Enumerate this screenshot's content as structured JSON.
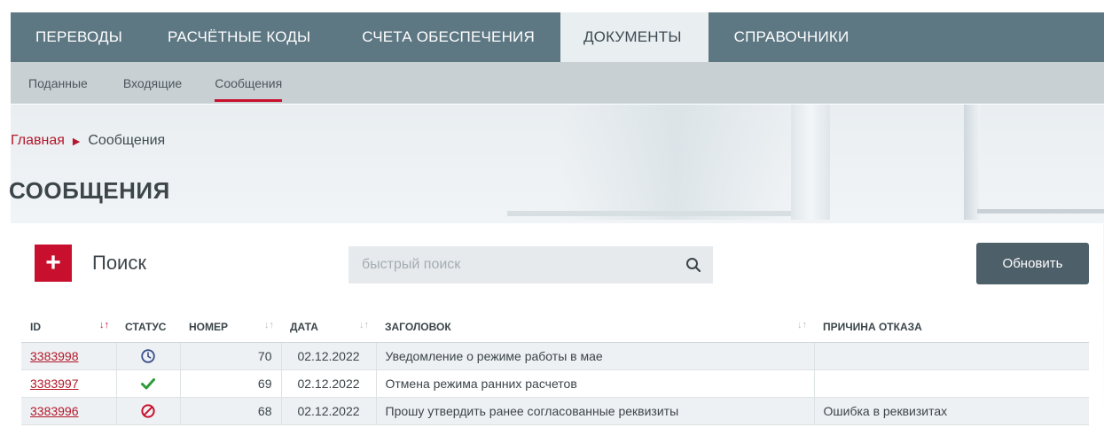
{
  "topnav": {
    "items": [
      {
        "label": "ПЕРЕВОДЫ",
        "active": false
      },
      {
        "label": "РАСЧЁТНЫЕ КОДЫ",
        "active": false
      },
      {
        "label": "СЧЕТА ОБЕСПЕЧЕНИЯ",
        "active": false
      },
      {
        "label": "ДОКУМЕНТЫ",
        "active": true
      },
      {
        "label": "СПРАВОЧНИКИ",
        "active": false
      }
    ]
  },
  "subnav": {
    "items": [
      {
        "label": "Поданные",
        "active": false
      },
      {
        "label": "Входящие",
        "active": false
      },
      {
        "label": "Сообщения",
        "active": true
      }
    ]
  },
  "breadcrumb": {
    "home": "Главная",
    "current": "Сообщения"
  },
  "page_title": "СООБЩЕНИЯ",
  "toolbar": {
    "add_icon": "plus-icon",
    "search_label": "Поиск",
    "quick_search_placeholder": "быстрый поиск",
    "quick_search_value": "",
    "search_icon": "magnifier-icon",
    "refresh_label": "Обновить"
  },
  "table": {
    "columns": [
      {
        "key": "id",
        "label": "ID",
        "sort": "active-desc"
      },
      {
        "key": "status",
        "label": "СТАТУС",
        "sort": "none"
      },
      {
        "key": "number",
        "label": "НОМЕР",
        "sort": "sortable"
      },
      {
        "key": "date",
        "label": "ДАТА",
        "sort": "sortable"
      },
      {
        "key": "title",
        "label": "ЗАГОЛОВОК",
        "sort": "sortable"
      },
      {
        "key": "reason",
        "label": "ПРИЧИНА ОТКАЗА",
        "sort": "none"
      }
    ],
    "rows": [
      {
        "id": "3383998",
        "status": "clock-icon",
        "number": "70",
        "date": "02.12.2022",
        "title": "Уведомление о режиме работы в мае",
        "reason": ""
      },
      {
        "id": "3383997",
        "status": "checkmark-icon",
        "number": "69",
        "date": "02.12.2022",
        "title": "Отмена режима ранних расчетов",
        "reason": ""
      },
      {
        "id": "3383996",
        "status": "prohibited-icon",
        "number": "68",
        "date": "02.12.2022",
        "title": "Прошу утвердить ранее согласованные реквизиты",
        "reason": "Ошибка в реквизитах"
      }
    ]
  },
  "colors": {
    "accent_red": "#c8102e",
    "nav_bg": "#5d7783",
    "subnav_bg": "#c9d0d4",
    "status_clock": "#3a4f8c",
    "status_ok": "#2e9b3a",
    "status_rejected": "#c8102e"
  }
}
